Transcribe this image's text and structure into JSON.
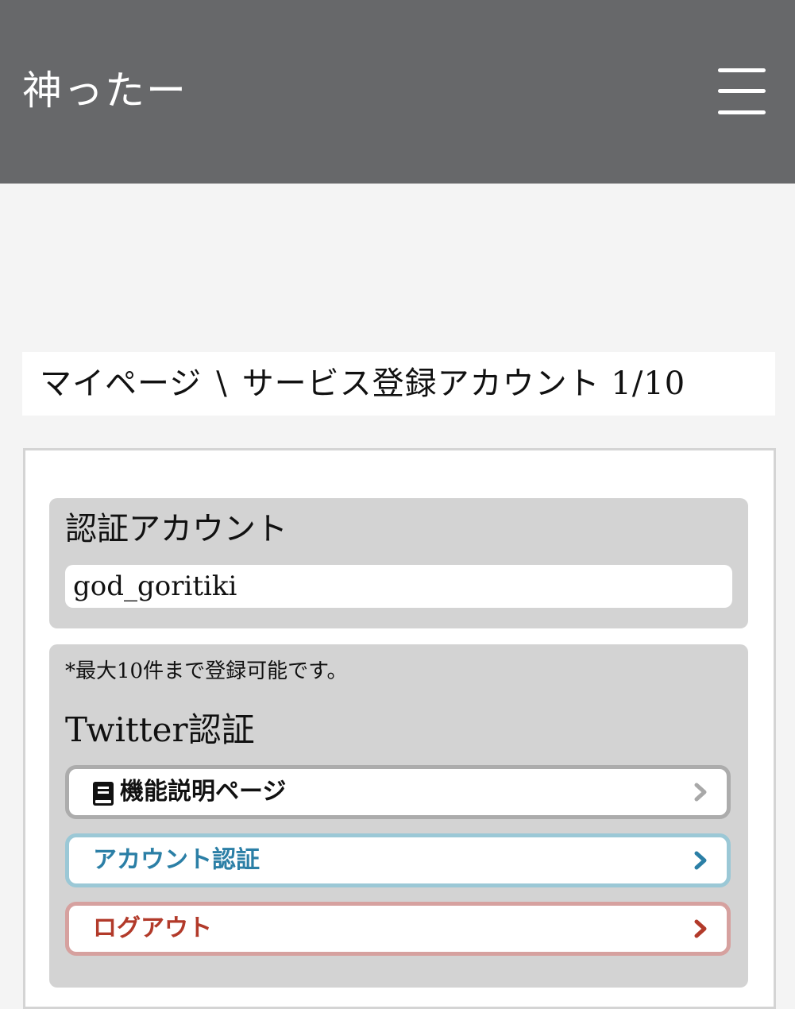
{
  "header": {
    "site_title": "神ったー",
    "menu_icon": "hamburger-menu-icon",
    "background_color": "#67686a"
  },
  "breadcrumb": {
    "home": "マイページ",
    "separator": "\\",
    "current": "サービス登録アカウント 1/10"
  },
  "auth_account": {
    "title": "認証アカウント",
    "value": "god_goritiki"
  },
  "twitter_section": {
    "note": "*最大10件まで登録可能です。",
    "title": "Twitter認証",
    "buttons": [
      {
        "label": "機能説明ページ",
        "icon": "book-icon",
        "color": "#111111",
        "border_color": "#acacac",
        "chevron_color": "#a8a8a8"
      },
      {
        "label": "アカウント認証",
        "color": "#2b7fa6",
        "border_color": "#9bc8d6",
        "chevron_color": "#2b7fa6"
      },
      {
        "label": "ログアウト",
        "color": "#b23a2a",
        "border_color": "#d6a19f",
        "chevron_color": "#b23a2a"
      }
    ]
  }
}
